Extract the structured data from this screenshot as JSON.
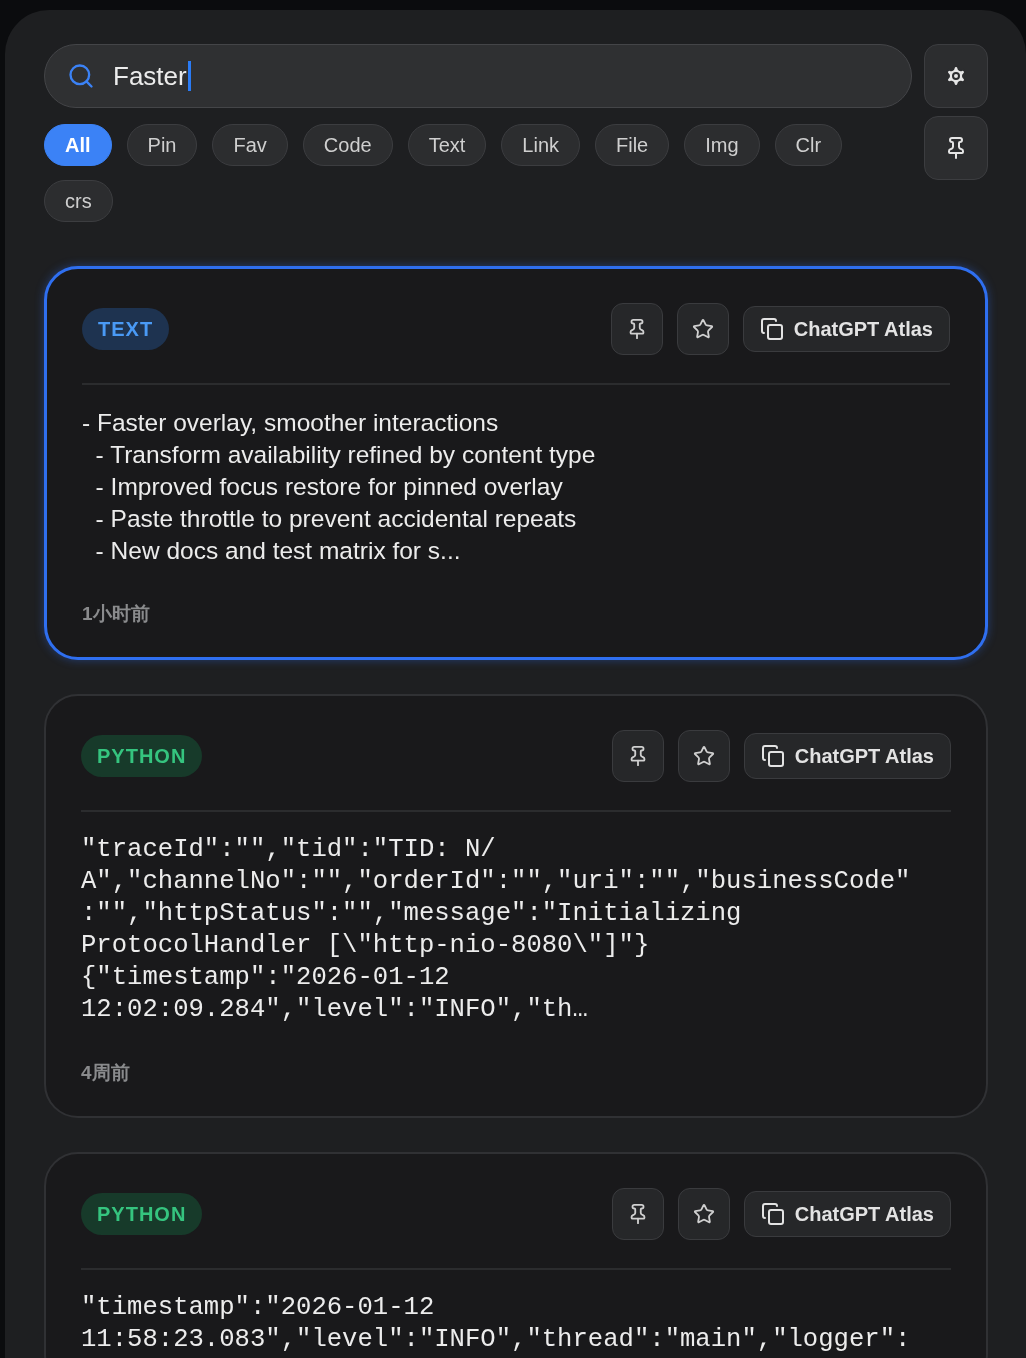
{
  "search": {
    "value": "Faster"
  },
  "filters": [
    {
      "label": "All",
      "selected": true
    },
    {
      "label": "Pin",
      "selected": false
    },
    {
      "label": "Fav",
      "selected": false
    },
    {
      "label": "Code",
      "selected": false
    },
    {
      "label": "Text",
      "selected": false
    },
    {
      "label": "Link",
      "selected": false
    },
    {
      "label": "File",
      "selected": false
    },
    {
      "label": "Img",
      "selected": false
    },
    {
      "label": "Clr",
      "selected": false
    },
    {
      "label": "crs",
      "selected": false
    }
  ],
  "cards": [
    {
      "selected": true,
      "tag": {
        "label": "TEXT",
        "kind": "text"
      },
      "source": "ChatGPT Atlas",
      "kind": "text",
      "lines": [
        "- Faster overlay, smoother interactions",
        "  - Transform availability refined by content type",
        "  - Improved focus restore for pinned overlay",
        "  - Paste throttle to prevent accidental repeats",
        "  - New docs and test matrix for s..."
      ],
      "time": "1小时前"
    },
    {
      "selected": false,
      "tag": {
        "label": "PYTHON",
        "kind": "code"
      },
      "source": "ChatGPT Atlas",
      "kind": "code",
      "lines": [
        "\"traceId\":\"\",\"tid\":\"TID: N/",
        "A\",\"channelNo\":\"\",\"orderId\":\"\",\"uri\":\"\",\"businessCode\"",
        ":\"\",\"httpStatus\":\"\",\"message\":\"Initializing",
        "ProtocolHandler [\\\"http-nio-8080\\\"]\"}",
        "{\"timestamp\":\"2026-01-12",
        "12:02:09.284\",\"level\":\"INFO\",\"th…"
      ],
      "time": "4周前"
    },
    {
      "selected": false,
      "tag": {
        "label": "PYTHON",
        "kind": "code"
      },
      "source": "ChatGPT Atlas",
      "kind": "code",
      "lines": [
        "\"timestamp\":\"2026-01-12",
        "11:58:23.083\",\"level\":\"INFO\",\"thread\":\"main\",\"logger\":"
      ]
    }
  ]
}
